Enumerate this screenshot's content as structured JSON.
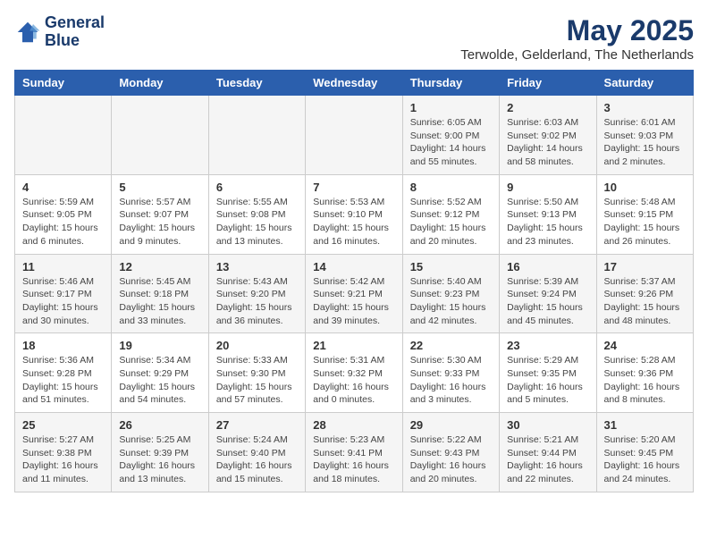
{
  "header": {
    "logo_line1": "General",
    "logo_line2": "Blue",
    "month": "May 2025",
    "location": "Terwolde, Gelderland, The Netherlands"
  },
  "weekdays": [
    "Sunday",
    "Monday",
    "Tuesday",
    "Wednesday",
    "Thursday",
    "Friday",
    "Saturday"
  ],
  "weeks": [
    [
      {
        "day": "",
        "info": ""
      },
      {
        "day": "",
        "info": ""
      },
      {
        "day": "",
        "info": ""
      },
      {
        "day": "",
        "info": ""
      },
      {
        "day": "1",
        "info": "Sunrise: 6:05 AM\nSunset: 9:00 PM\nDaylight: 14 hours\nand 55 minutes."
      },
      {
        "day": "2",
        "info": "Sunrise: 6:03 AM\nSunset: 9:02 PM\nDaylight: 14 hours\nand 58 minutes."
      },
      {
        "day": "3",
        "info": "Sunrise: 6:01 AM\nSunset: 9:03 PM\nDaylight: 15 hours\nand 2 minutes."
      }
    ],
    [
      {
        "day": "4",
        "info": "Sunrise: 5:59 AM\nSunset: 9:05 PM\nDaylight: 15 hours\nand 6 minutes."
      },
      {
        "day": "5",
        "info": "Sunrise: 5:57 AM\nSunset: 9:07 PM\nDaylight: 15 hours\nand 9 minutes."
      },
      {
        "day": "6",
        "info": "Sunrise: 5:55 AM\nSunset: 9:08 PM\nDaylight: 15 hours\nand 13 minutes."
      },
      {
        "day": "7",
        "info": "Sunrise: 5:53 AM\nSunset: 9:10 PM\nDaylight: 15 hours\nand 16 minutes."
      },
      {
        "day": "8",
        "info": "Sunrise: 5:52 AM\nSunset: 9:12 PM\nDaylight: 15 hours\nand 20 minutes."
      },
      {
        "day": "9",
        "info": "Sunrise: 5:50 AM\nSunset: 9:13 PM\nDaylight: 15 hours\nand 23 minutes."
      },
      {
        "day": "10",
        "info": "Sunrise: 5:48 AM\nSunset: 9:15 PM\nDaylight: 15 hours\nand 26 minutes."
      }
    ],
    [
      {
        "day": "11",
        "info": "Sunrise: 5:46 AM\nSunset: 9:17 PM\nDaylight: 15 hours\nand 30 minutes."
      },
      {
        "day": "12",
        "info": "Sunrise: 5:45 AM\nSunset: 9:18 PM\nDaylight: 15 hours\nand 33 minutes."
      },
      {
        "day": "13",
        "info": "Sunrise: 5:43 AM\nSunset: 9:20 PM\nDaylight: 15 hours\nand 36 minutes."
      },
      {
        "day": "14",
        "info": "Sunrise: 5:42 AM\nSunset: 9:21 PM\nDaylight: 15 hours\nand 39 minutes."
      },
      {
        "day": "15",
        "info": "Sunrise: 5:40 AM\nSunset: 9:23 PM\nDaylight: 15 hours\nand 42 minutes."
      },
      {
        "day": "16",
        "info": "Sunrise: 5:39 AM\nSunset: 9:24 PM\nDaylight: 15 hours\nand 45 minutes."
      },
      {
        "day": "17",
        "info": "Sunrise: 5:37 AM\nSunset: 9:26 PM\nDaylight: 15 hours\nand 48 minutes."
      }
    ],
    [
      {
        "day": "18",
        "info": "Sunrise: 5:36 AM\nSunset: 9:28 PM\nDaylight: 15 hours\nand 51 minutes."
      },
      {
        "day": "19",
        "info": "Sunrise: 5:34 AM\nSunset: 9:29 PM\nDaylight: 15 hours\nand 54 minutes."
      },
      {
        "day": "20",
        "info": "Sunrise: 5:33 AM\nSunset: 9:30 PM\nDaylight: 15 hours\nand 57 minutes."
      },
      {
        "day": "21",
        "info": "Sunrise: 5:31 AM\nSunset: 9:32 PM\nDaylight: 16 hours\nand 0 minutes."
      },
      {
        "day": "22",
        "info": "Sunrise: 5:30 AM\nSunset: 9:33 PM\nDaylight: 16 hours\nand 3 minutes."
      },
      {
        "day": "23",
        "info": "Sunrise: 5:29 AM\nSunset: 9:35 PM\nDaylight: 16 hours\nand 5 minutes."
      },
      {
        "day": "24",
        "info": "Sunrise: 5:28 AM\nSunset: 9:36 PM\nDaylight: 16 hours\nand 8 minutes."
      }
    ],
    [
      {
        "day": "25",
        "info": "Sunrise: 5:27 AM\nSunset: 9:38 PM\nDaylight: 16 hours\nand 11 minutes."
      },
      {
        "day": "26",
        "info": "Sunrise: 5:25 AM\nSunset: 9:39 PM\nDaylight: 16 hours\nand 13 minutes."
      },
      {
        "day": "27",
        "info": "Sunrise: 5:24 AM\nSunset: 9:40 PM\nDaylight: 16 hours\nand 15 minutes."
      },
      {
        "day": "28",
        "info": "Sunrise: 5:23 AM\nSunset: 9:41 PM\nDaylight: 16 hours\nand 18 minutes."
      },
      {
        "day": "29",
        "info": "Sunrise: 5:22 AM\nSunset: 9:43 PM\nDaylight: 16 hours\nand 20 minutes."
      },
      {
        "day": "30",
        "info": "Sunrise: 5:21 AM\nSunset: 9:44 PM\nDaylight: 16 hours\nand 22 minutes."
      },
      {
        "day": "31",
        "info": "Sunrise: 5:20 AM\nSunset: 9:45 PM\nDaylight: 16 hours\nand 24 minutes."
      }
    ]
  ]
}
